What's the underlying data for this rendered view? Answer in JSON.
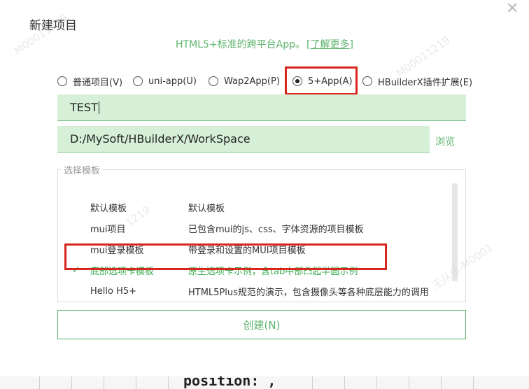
{
  "dialog": {
    "title": "新建项目",
    "close_glyph": "✕",
    "subtitle_text": "HTML5+标准的跨平台App。",
    "subtitle_link": "[了解更多]"
  },
  "project_types": [
    {
      "label": "普通项目(V)",
      "checked": false
    },
    {
      "label": "uni-app(U)",
      "checked": false
    },
    {
      "label": "Wap2App(P)",
      "checked": false
    },
    {
      "label": "5+App(A)",
      "checked": true
    },
    {
      "label": "HBuilderX插件扩展(E)",
      "checked": false
    }
  ],
  "project_name": {
    "value": "TEST"
  },
  "location": {
    "value": "D:/MySoft/HBuilderX/WorkSpace",
    "browse_label": "浏览"
  },
  "templates": {
    "legend": "选择模板",
    "rows": [
      {
        "name": "默认模板",
        "desc": "默认模板",
        "selected": false
      },
      {
        "name": "mui项目",
        "desc": "已包含mui的js、css、字体资源的项目模板",
        "selected": false
      },
      {
        "name": "mui登录模板",
        "desc": "带登录和设置的MUI项目模板",
        "selected": false
      },
      {
        "name": "底部选项卡模板",
        "desc": "原生选项卡示例，含tab中部凸起半圆示例",
        "selected": true,
        "check": "✓"
      },
      {
        "name": "Hello H5+",
        "desc": "HTML5Plus规范的演示，包含摄像头等各种底层能力的调用",
        "selected": false
      }
    ]
  },
  "create_button": {
    "label": "创建(N)"
  },
  "watermark": {
    "lines": [
      "M00011219",
      "王从伟-M0001",
      "1219",
      "M00011219"
    ]
  },
  "underlay": {
    "code_text": "position: ,"
  },
  "colors": {
    "accent": "#5bb36b",
    "input_bg": "#d6efd7",
    "highlight": "#d9261c"
  }
}
